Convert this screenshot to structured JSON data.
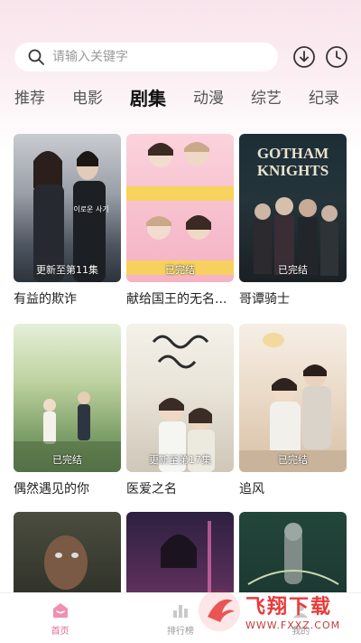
{
  "search": {
    "placeholder": "请输入关键字"
  },
  "tabs": [
    {
      "label": "推荐"
    },
    {
      "label": "电影"
    },
    {
      "label": "剧集"
    },
    {
      "label": "动漫"
    },
    {
      "label": "综艺"
    },
    {
      "label": "纪录"
    }
  ],
  "active_tab": "剧集",
  "cards": [
    {
      "title": "有益的欺诈",
      "badge": "更新至第11集",
      "art_text": ""
    },
    {
      "title": "献给国王的无名...",
      "badge": "已完结",
      "art_text": ""
    },
    {
      "title": "哥谭骑士",
      "badge": "已完结",
      "art_text": "GOTHAM KNIGHTS"
    },
    {
      "title": "偶然遇见的你",
      "badge": "已完结",
      "art_text": ""
    },
    {
      "title": "医爱之名",
      "badge": "更新至第17集",
      "art_text": ""
    },
    {
      "title": "追风",
      "badge": "已完结",
      "art_text": ""
    },
    {
      "title": "",
      "badge": "",
      "art_text": ""
    },
    {
      "title": "",
      "badge": "",
      "art_text": ""
    },
    {
      "title": "",
      "badge": "",
      "art_text": ""
    }
  ],
  "bottom_nav": [
    {
      "label": "首页",
      "icon": "home-icon"
    },
    {
      "label": "排行榜",
      "icon": "ranking-icon"
    },
    {
      "label": "我的",
      "icon": "profile-icon"
    }
  ],
  "watermark": {
    "big": "飞翔下载",
    "small": "WWW.FXXZ.COM"
  },
  "colors": {
    "accent": "#e86b95",
    "background_top": "#f9e4ec",
    "watermark": "#e73a3a"
  }
}
